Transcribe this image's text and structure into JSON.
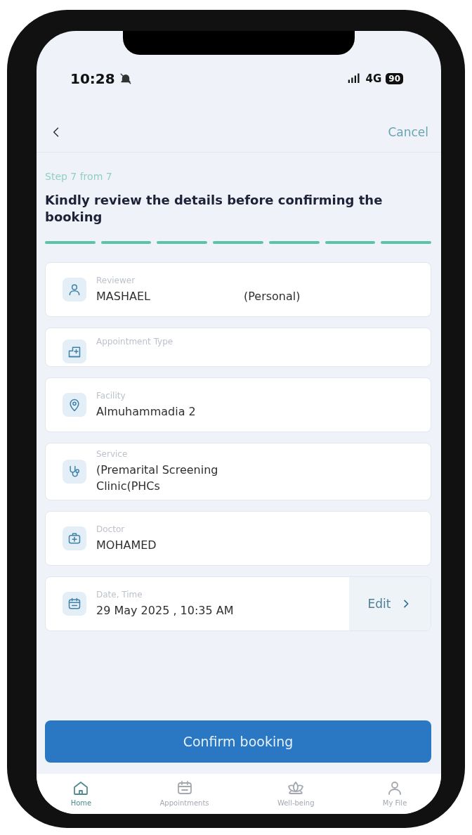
{
  "status_bar": {
    "time": "10:28",
    "network": "4G",
    "battery": "90"
  },
  "nav": {
    "cancel": "Cancel"
  },
  "step_label": "Step 7 from 7",
  "heading": "Kindly review the details before confirming the booking",
  "steps": [
    {
      "done": true
    },
    {
      "done": true
    },
    {
      "done": true
    },
    {
      "done": true
    },
    {
      "done": true
    },
    {
      "done": true
    },
    {
      "done": true
    }
  ],
  "details": [
    {
      "kind": "person",
      "label": "Reviewer",
      "value": "MASHAEL",
      "note": "(Personal)"
    },
    {
      "kind": "building",
      "label": "Appointment Type"
    },
    {
      "kind": "pin",
      "label": "Facility",
      "value": "Almuhammadia 2"
    },
    {
      "kind": "stethoscope",
      "label": "Service",
      "value": "(Premarital Screening\nClinic(PHCs"
    },
    {
      "kind": "medkit",
      "label": "Doctor",
      "value": "MOHAMED"
    },
    {
      "kind": "calendar",
      "label": "Date, Time",
      "value": "29 May 2025 , 10:35 AM",
      "action": "Edit"
    }
  ],
  "confirm_button": "Confirm booking",
  "tab_bar": [
    {
      "kind": "home",
      "label": "Home",
      "selected": true
    },
    {
      "kind": "calendar",
      "label": "Appointments",
      "selected": false
    },
    {
      "kind": "lotus",
      "label": "Well-being",
      "selected": false
    },
    {
      "kind": "person",
      "label": "My File",
      "selected": false
    }
  ]
}
